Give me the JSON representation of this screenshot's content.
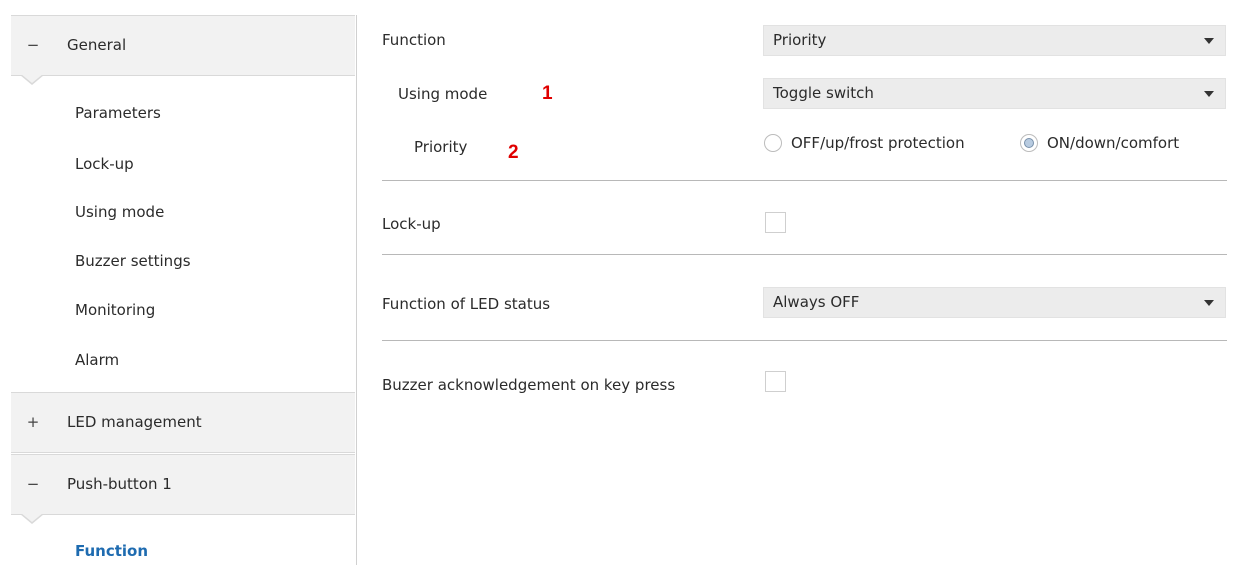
{
  "sidebar": {
    "groups": [
      {
        "symbol": "−",
        "label": "General"
      },
      {
        "symbol": "+",
        "label": "LED management"
      },
      {
        "symbol": "−",
        "label": "Push-button 1"
      }
    ],
    "general_items": [
      "Parameters",
      "Lock-up",
      "Using mode",
      "Buzzer settings",
      "Monitoring",
      "Alarm"
    ],
    "push_items": [
      "Function"
    ]
  },
  "main": {
    "function": {
      "label": "Function",
      "value": "Priority"
    },
    "using_mode": {
      "label": "Using mode",
      "marker": "1",
      "value": "Toggle switch"
    },
    "priority": {
      "label": "Priority",
      "marker": "2",
      "option1": "OFF/up/frost protection",
      "option2": "ON/down/comfort",
      "selected": "ON/down/comfort"
    },
    "lockup": {
      "label": "Lock-up",
      "checked": false
    },
    "led_status": {
      "label": "Function of LED status",
      "value": "Always OFF"
    },
    "buzzer_ack": {
      "label": "Buzzer acknowledgement on key press",
      "checked": false
    }
  }
}
